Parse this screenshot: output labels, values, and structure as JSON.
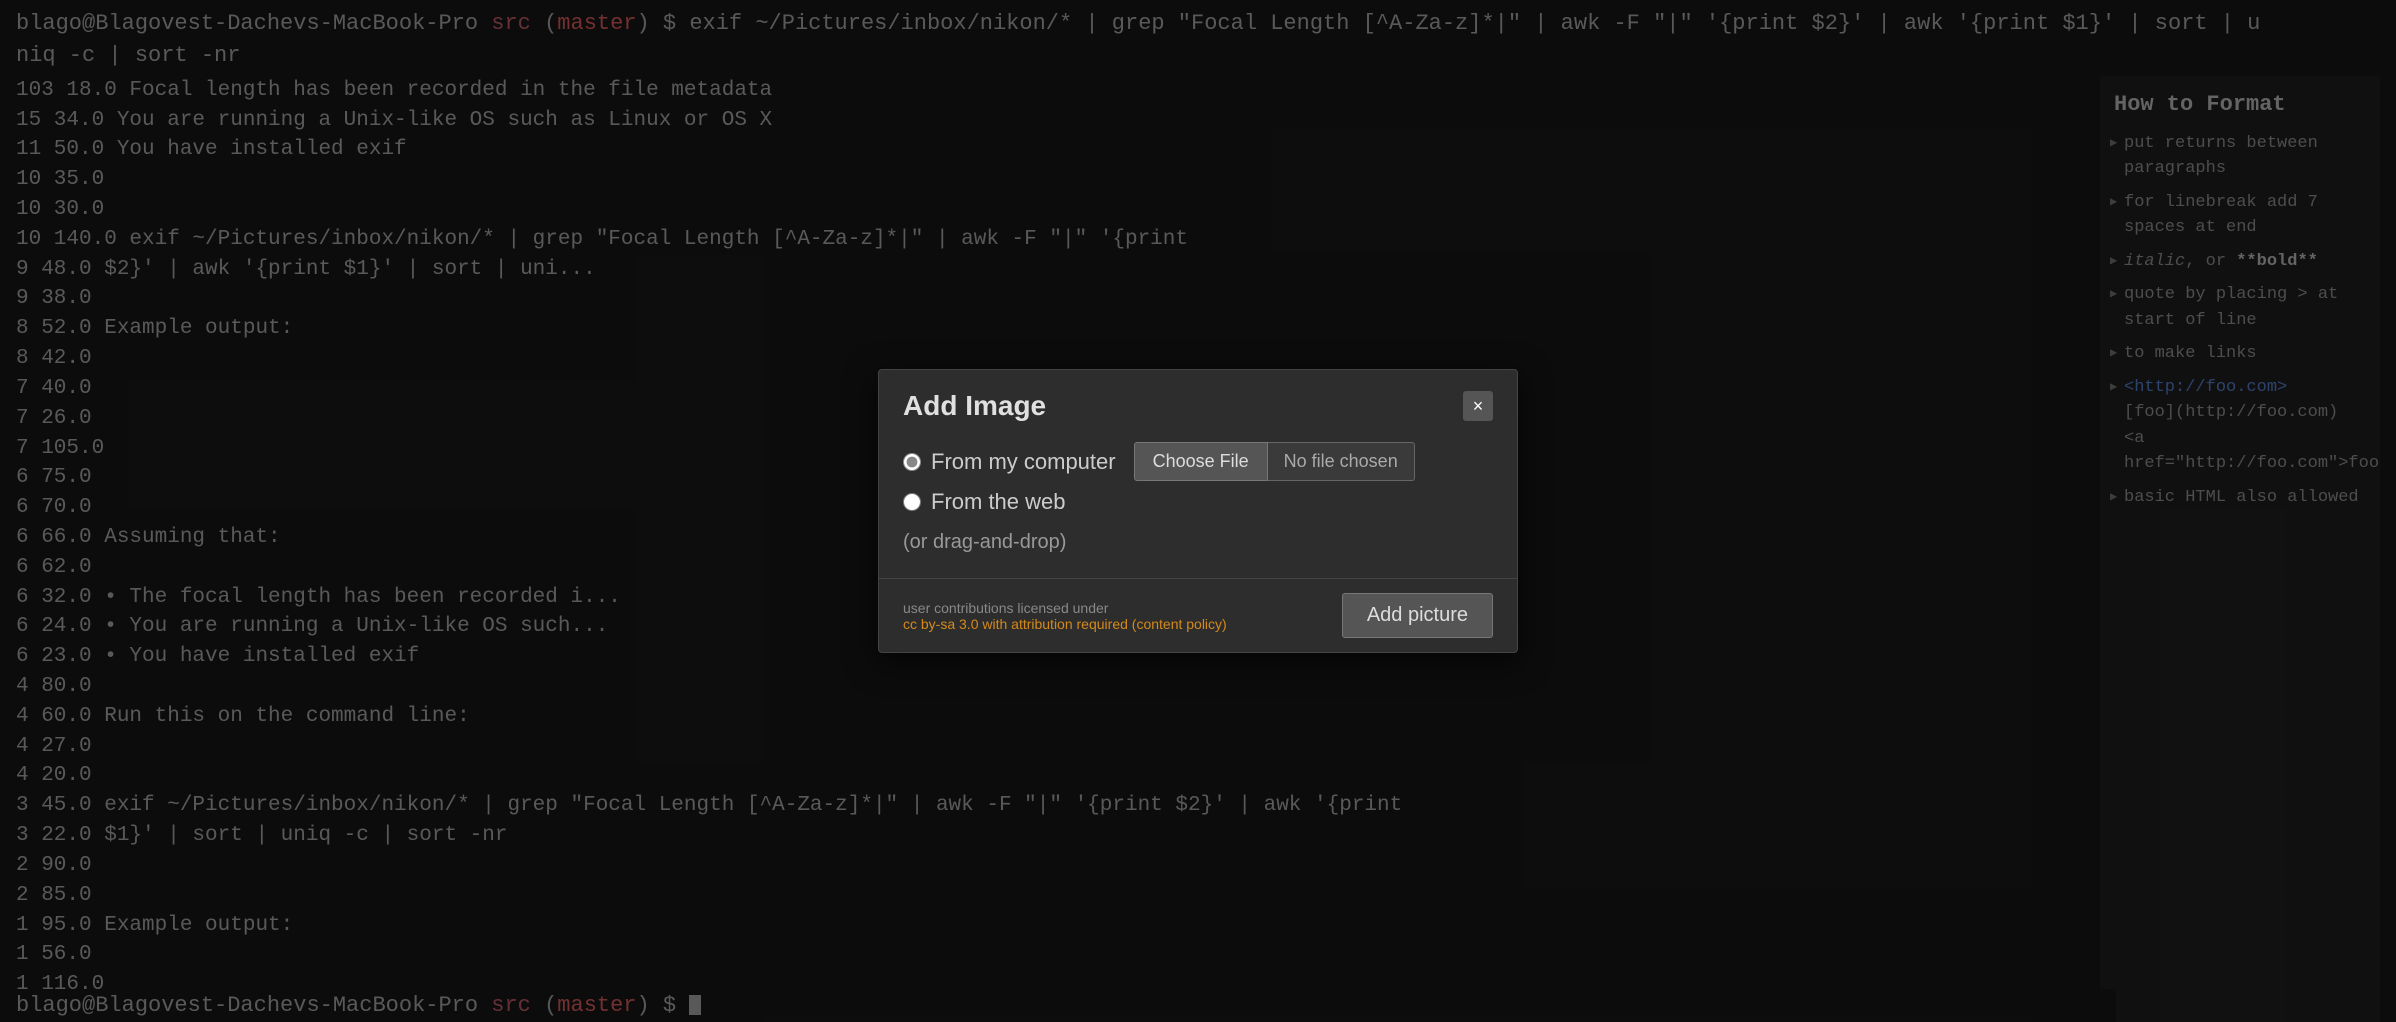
{
  "terminal": {
    "top_bar": "blago@Blagovest-Dachevs-MacBook-Pro src (master) $ exif ~/Pictures/inbox/nikon/* | grep \"Focal Length [^A-Za-z]*|\" | awk -F \"|\" '{print $2}' | awk '{print $1}' | sort | uniq -c | sort -nr",
    "bottom_bar_prefix": "blago@Blagovest-Dachevs-MacBook-Pro",
    "bottom_bar_src": "src",
    "bottom_bar_branch": "(master)",
    "bottom_bar_suffix": "$",
    "lines": [
      "103 18.0",
      " 15 34.0   You are running a Unix-like OS such as Linux or OS X",
      " 11 50.0   You have installed exif",
      " 10 35.0",
      " 10 30.0",
      " 10 140.0  exif ~/Pictures/inbox/nikon/* | grep \"Focal Length [^A-Za-z]*|\" | awk -F \"|\" '{print",
      "  9 48.0   $2}' | awk '{print $1}' | sort | uni...",
      "  9 38.0",
      "  8 52.0   Example output:",
      "  8 42.0",
      "  7 40.0",
      "  7 26.0",
      "  7 105.0",
      "  6 75.0",
      "  6 70.0",
      "  6 66.0   Assuming that:",
      "  6 62.0",
      "  6 32.0     • The focal length has been recorded i...",
      "  6 24.0     • You are running a Unix-like OS such ...",
      "  6 23.0     • You have installed exif",
      "  4 80.0",
      "  4 60.0   Run this on the command line:",
      "  4 27.0",
      "  4 20.0",
      "  3 45.0   exif ~/Pictures/inbox/nikon/* | grep \"Focal Length [^A-Za-z]*|\" | awk -F \"|\" '{print $2}' | awk '{print",
      "  3 22.0   $1}' | sort | uniq -c | sort -nr",
      "  2 90.0",
      "  2 85.0",
      "  1 95.0   Example output:",
      "  1 56.0",
      "  1 116.0"
    ]
  },
  "sidebar": {
    "title": "How to Format",
    "items": [
      {
        "text": "put returns between paragraphs"
      },
      {
        "text": "for linebreak add 7 spaces at end"
      },
      {
        "text": "italic, or **bold**"
      },
      {
        "text": "quote by placing > at start of line"
      },
      {
        "text": "to make links"
      },
      {
        "text": "<http://foo.com> [foo](http://foo.com) <a href=\"http://foo.com\">foo</a>"
      },
      {
        "text": "basic HTML also allowed"
      }
    ]
  },
  "modal": {
    "title": "Add Image",
    "close_label": "×",
    "options": [
      {
        "id": "from-computer",
        "label": "From my computer",
        "checked": true
      },
      {
        "id": "from-web",
        "label": "From the web",
        "checked": false
      }
    ],
    "choose_file_label": "Choose File",
    "no_file_label": "No file chosen",
    "drag_drop_label": "(or drag-and-drop)",
    "license_line1": "user contributions licensed under",
    "license_link": "cc by-sa 3.0 with attribution required (content policy)",
    "add_picture_label": "Add picture"
  }
}
